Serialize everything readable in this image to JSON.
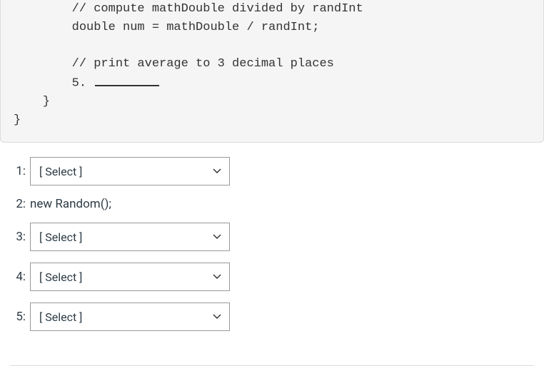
{
  "code": {
    "line1": "        // compute mathDouble divided by randInt",
    "line2": "        double num = mathDouble / randInt;",
    "line3": "",
    "line4": "        // print average to 3 decimal places",
    "line5_prefix": "        5. ",
    "line6": "    }",
    "line7": "}"
  },
  "answers": {
    "item1": {
      "label": "1:",
      "value": "[ Select ]"
    },
    "item2": {
      "label": "2:",
      "text": "new Random();"
    },
    "item3": {
      "label": "3:",
      "value": "[ Select ]"
    },
    "item4": {
      "label": "4:",
      "value": "[ Select ]"
    },
    "item5": {
      "label": "5:",
      "value": "[ Select ]"
    }
  }
}
